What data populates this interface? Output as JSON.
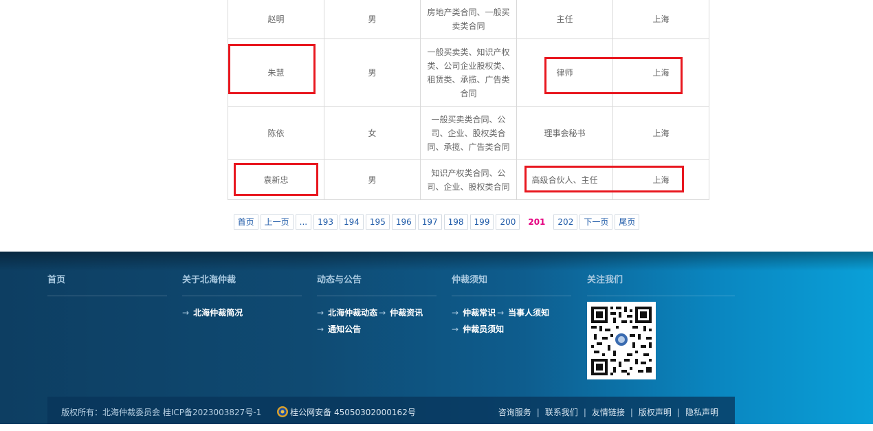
{
  "table": {
    "rows": [
      {
        "name": "赵明",
        "gender": "男",
        "skill": "房地产类合同、一般买卖类合同",
        "title": "主任",
        "city": "上海"
      },
      {
        "name": "朱慧",
        "gender": "男",
        "skill": "一般买卖类、知识产权类、公司企业股权类、租赁类、承揽、广告类合同",
        "title": "律师",
        "city": "上海"
      },
      {
        "name": "陈依",
        "gender": "女",
        "skill": "一般买卖类合同、公司、企业、股权类合同、承揽、广告类合同",
        "title": "理事会秘书",
        "city": "上海"
      },
      {
        "name": "袁新忠",
        "gender": "男",
        "skill": "知识产权类合同、公司、企业、股权类合同",
        "title": "高级合伙人、主任",
        "city": "上海"
      }
    ]
  },
  "pagination": {
    "first": "首页",
    "prev": "上一页",
    "ellipsis": "...",
    "pages": [
      "193",
      "194",
      "195",
      "196",
      "197",
      "198",
      "199",
      "200"
    ],
    "current": "201",
    "after": [
      "202"
    ],
    "next": "下一页",
    "last": "尾页"
  },
  "footer": {
    "columns": [
      {
        "title": "首页",
        "links": []
      },
      {
        "title": "关于北海仲裁",
        "links": [
          "北海仲裁简况"
        ]
      },
      {
        "title": "动态与公告",
        "links": [
          "北海仲裁动态",
          "仲裁资讯",
          "通知公告"
        ]
      },
      {
        "title": "仲裁须知",
        "links": [
          "仲裁常识",
          "当事人须知",
          "仲裁员须知"
        ]
      },
      {
        "title": "关注我们",
        "links": []
      }
    ],
    "copyright": "版权所有：北海仲裁委员会 桂ICP备2023003827号-1",
    "police": "桂公网安备 45050302000162号",
    "bottom_links": [
      "咨询服务",
      "联系我们",
      "友情链接",
      "版权声明",
      "隐私声明"
    ]
  },
  "colors": {
    "highlight": "#e8171f",
    "current_page": "#e4007f",
    "link": "#1e5aa8"
  }
}
